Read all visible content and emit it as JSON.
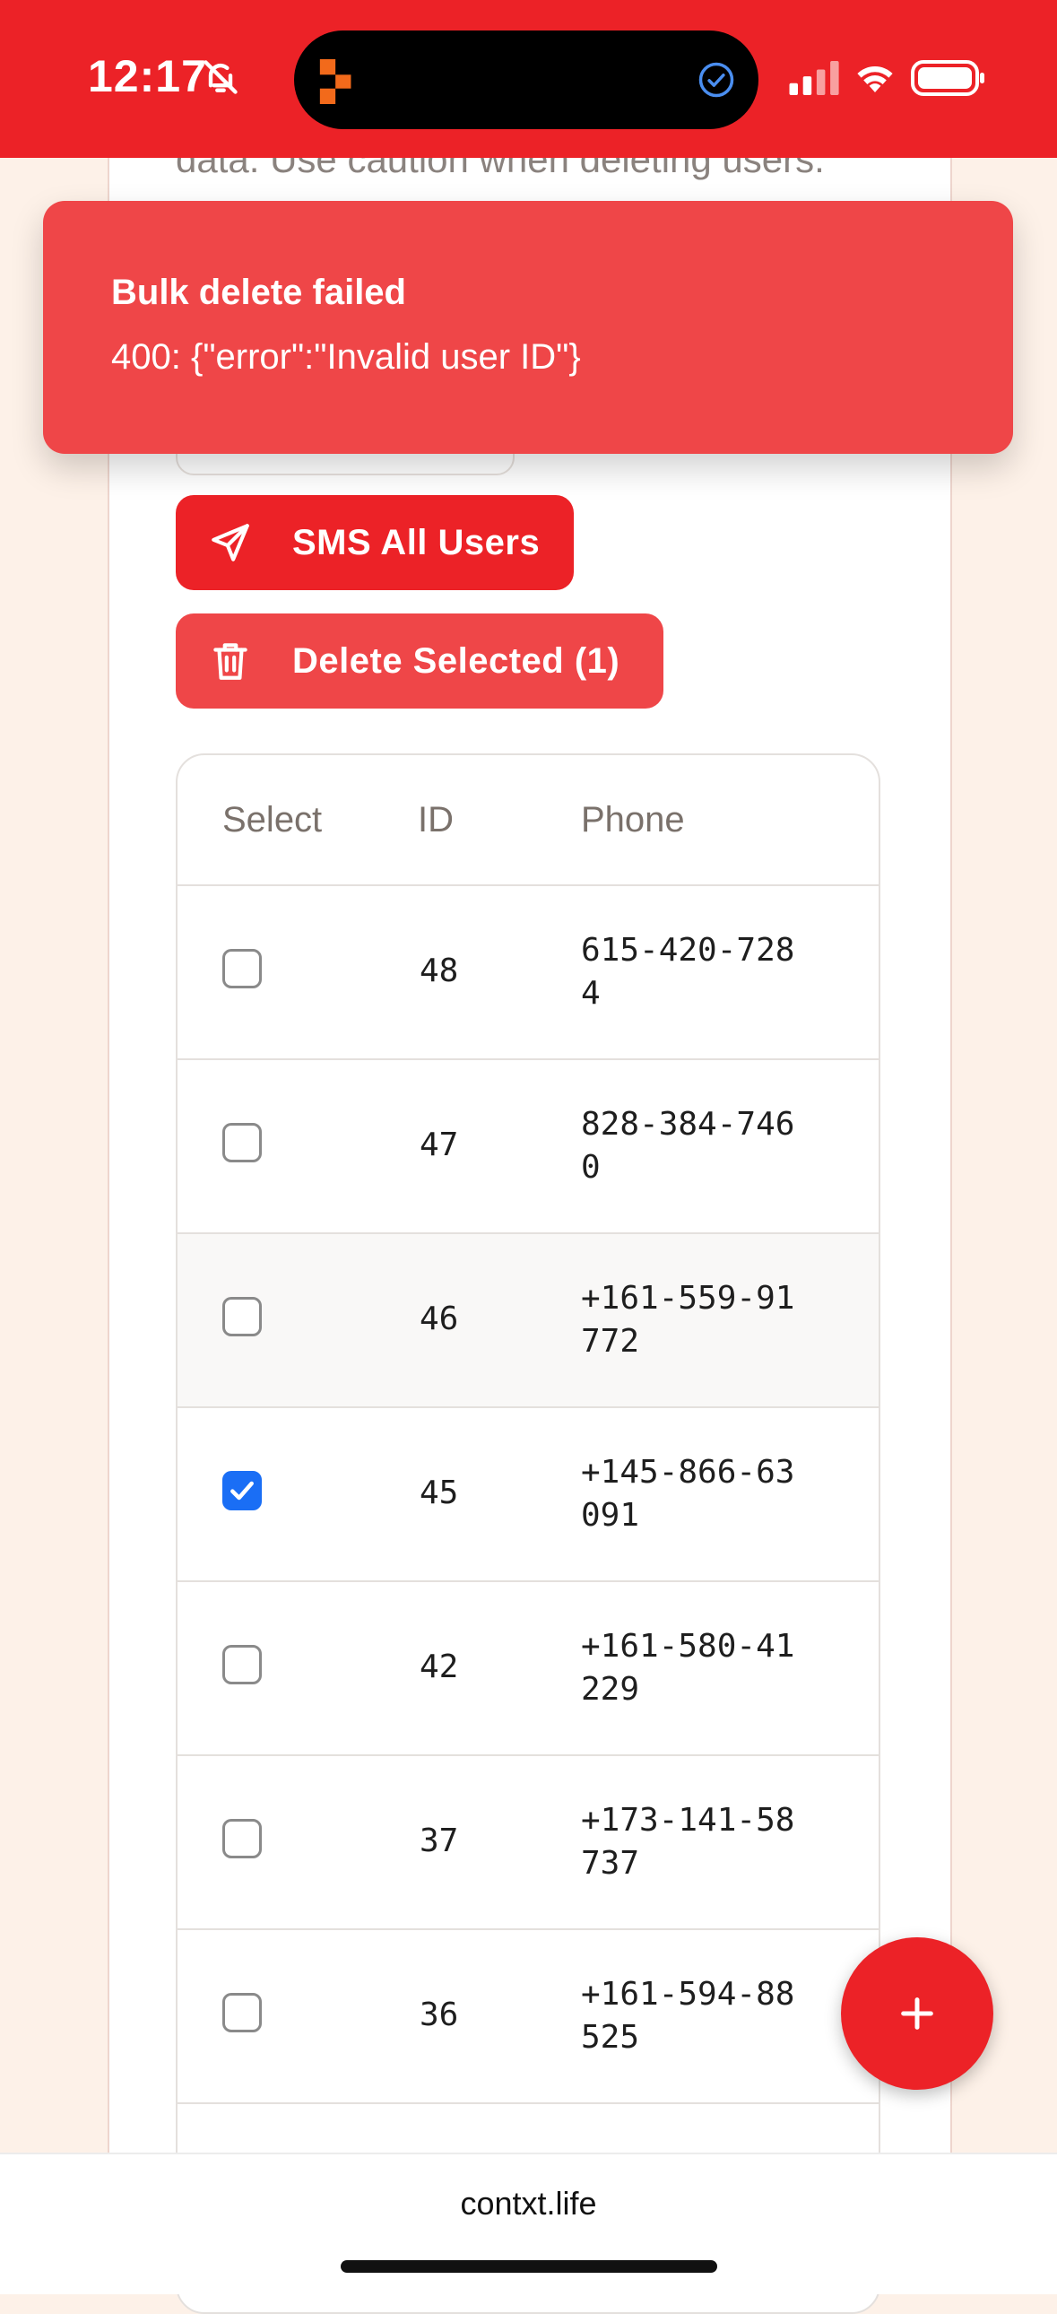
{
  "status_bar": {
    "time": "12:17",
    "background": "#ec2227",
    "icons": [
      "bell-slash-icon",
      "app-icon",
      "check-circle-icon",
      "cellular-signal-icon",
      "wifi-icon",
      "battery-icon"
    ]
  },
  "page": {
    "caution_text": "data. Use caution when deleting users.",
    "sms_button": "SMS All Users",
    "delete_button": "Delete Selected (1)"
  },
  "toast": {
    "title": "Bulk delete failed",
    "message": "400: {\"error\":\"Invalid user ID\"}",
    "color": "#ef4648"
  },
  "table": {
    "headers": {
      "select": "Select",
      "id": "ID",
      "phone": "Phone"
    },
    "rows": [
      {
        "id": "48",
        "phone": "615-420-7284",
        "selected": false
      },
      {
        "id": "47",
        "phone": "828-384-7460",
        "selected": false
      },
      {
        "id": "46",
        "phone": "+161-559-91772",
        "selected": false
      },
      {
        "id": "45",
        "phone": "+145-866-63091",
        "selected": true
      },
      {
        "id": "42",
        "phone": "+161-580-41229",
        "selected": false
      },
      {
        "id": "37",
        "phone": "+173-141-58737",
        "selected": false
      },
      {
        "id": "36",
        "phone": "+161-594-88525",
        "selected": false
      }
    ]
  },
  "fab": {
    "icon": "plus-icon"
  },
  "browser": {
    "url": "contxt.life"
  },
  "colors": {
    "accent": "#ec2227",
    "checkbox_checked": "#1a6ef5"
  }
}
